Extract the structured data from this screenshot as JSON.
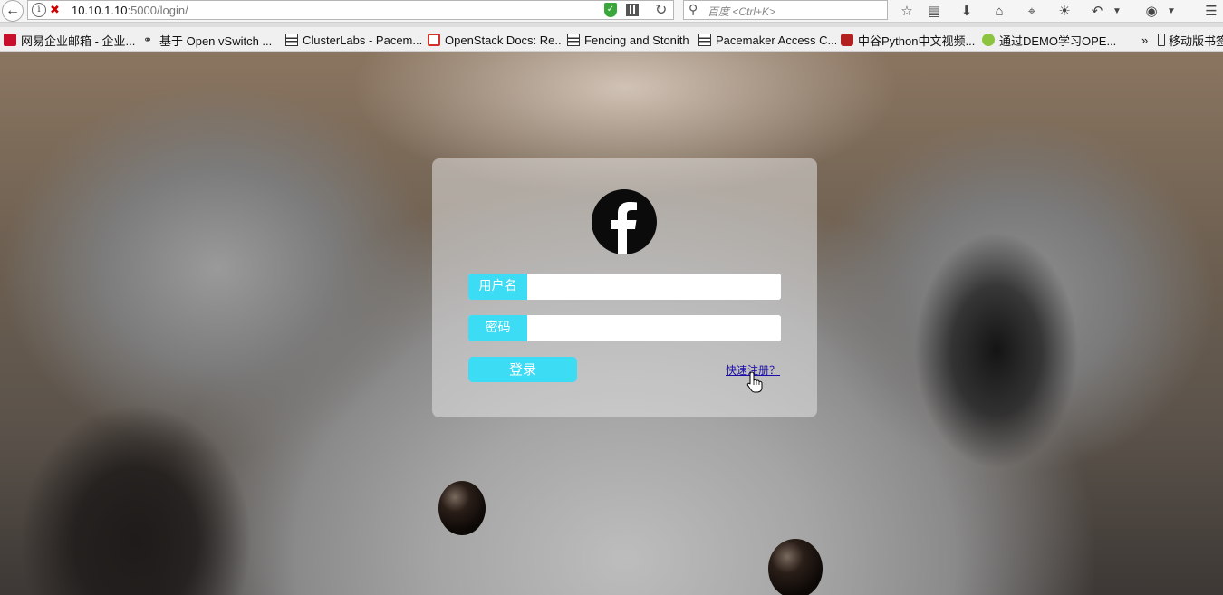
{
  "browser": {
    "url_host": "10.10.1.10",
    "url_rest": ":5000/login/",
    "search_placeholder": "百度 <Ctrl+K>"
  },
  "bookmarks": [
    {
      "label": "网易企业邮箱 - 企业...",
      "icon": "netease-icon"
    },
    {
      "label": "基于 Open vSwitch ...",
      "icon": "link-icon"
    },
    {
      "label": "ClusterLabs - Pacem...",
      "icon": "doc-icon"
    },
    {
      "label": "OpenStack Docs: Re...",
      "icon": "openstack-icon"
    },
    {
      "label": "Fencing and Stonith",
      "icon": "doc-icon"
    },
    {
      "label": "Pacemaker Access C...",
      "icon": "doc-icon"
    },
    {
      "label": "中谷Python中文视频...",
      "icon": "video-icon"
    },
    {
      "label": "通过DEMO学习OPE...",
      "icon": "green-icon"
    },
    {
      "label": "移动版书签",
      "icon": "mobile-icon"
    }
  ],
  "bookmarks_overflow": "»",
  "login": {
    "username_label": "用户名",
    "password_label": "密码",
    "username_value": "",
    "password_value": "",
    "submit_label": "登录",
    "register_link": "快速注册？"
  },
  "colors": {
    "accent": "#3ddcf5",
    "link": "#1a0dab",
    "logo_bg": "#0b0b0b"
  }
}
